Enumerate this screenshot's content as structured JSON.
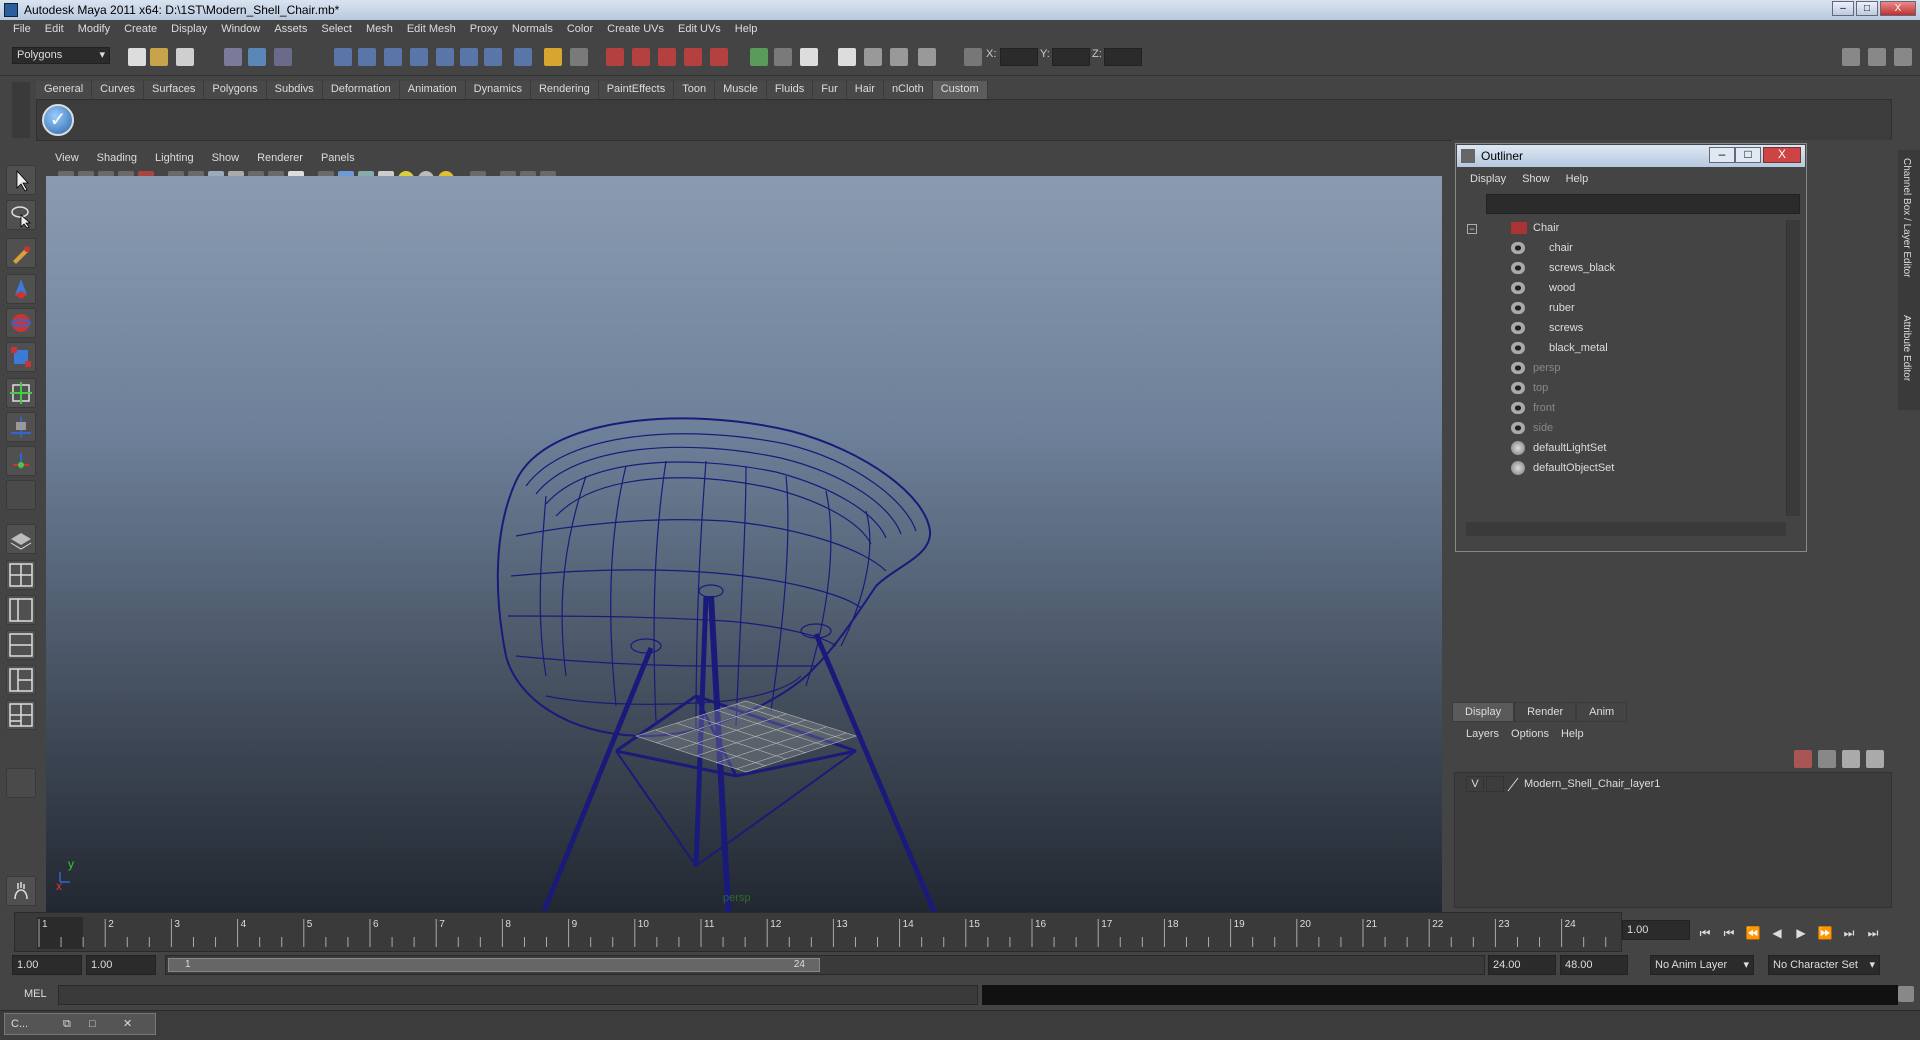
{
  "window": {
    "title": "Autodesk Maya 2011 x64: D:\\1ST\\Modern_Shell_Chair.mb*",
    "minimize": "–",
    "maximize": "□",
    "close": "X"
  },
  "menubar": [
    "File",
    "Edit",
    "Modify",
    "Create",
    "Display",
    "Window",
    "Assets",
    "Select",
    "Mesh",
    "Edit Mesh",
    "Proxy",
    "Normals",
    "Color",
    "Create UVs",
    "Edit UVs",
    "Help"
  ],
  "status_line": {
    "mode": "Polygons",
    "x_label": "X:",
    "y_label": "Y:",
    "z_label": "Z:"
  },
  "shelf": {
    "tabs": [
      "General",
      "Curves",
      "Surfaces",
      "Polygons",
      "Subdivs",
      "Deformation",
      "Animation",
      "Dynamics",
      "Rendering",
      "PaintEffects",
      "Toon",
      "Muscle",
      "Fluids",
      "Fur",
      "Hair",
      "nCloth",
      "Custom"
    ],
    "active_tab": "Custom"
  },
  "viewport": {
    "menu": [
      "View",
      "Shading",
      "Lighting",
      "Show",
      "Renderer",
      "Panels"
    ],
    "camera": "persp",
    "axis_x": "x",
    "axis_y": "y"
  },
  "outliner": {
    "title": "Outliner",
    "menu": [
      "Display",
      "Show",
      "Help"
    ],
    "items": [
      {
        "label": "Chair",
        "level": 0,
        "dim": false
      },
      {
        "label": "chair",
        "level": 1,
        "dim": false
      },
      {
        "label": "screws_black",
        "level": 1,
        "dim": false
      },
      {
        "label": "wood",
        "level": 1,
        "dim": false
      },
      {
        "label": "ruber",
        "level": 1,
        "dim": false
      },
      {
        "label": "screws",
        "level": 1,
        "dim": false
      },
      {
        "label": "black_metal",
        "level": 1,
        "dim": false
      },
      {
        "label": "persp",
        "level": 0,
        "dim": true
      },
      {
        "label": "top",
        "level": 0,
        "dim": true
      },
      {
        "label": "front",
        "level": 0,
        "dim": true
      },
      {
        "label": "side",
        "level": 0,
        "dim": true
      },
      {
        "label": "defaultLightSet",
        "level": 0,
        "dim": false
      },
      {
        "label": "defaultObjectSet",
        "level": 0,
        "dim": false
      }
    ]
  },
  "layer_editor": {
    "tabs": [
      "Display",
      "Render",
      "Anim"
    ],
    "active_tab": "Display",
    "menu": [
      "Layers",
      "Options",
      "Help"
    ],
    "layers": [
      {
        "visible": "V",
        "name": "Modern_Shell_Chair_layer1"
      }
    ]
  },
  "side_tabs": [
    "Channel Box / Layer Editor",
    "Attribute Editor"
  ],
  "timeline": {
    "ticks": [
      "1",
      "2",
      "3",
      "4",
      "5",
      "6",
      "7",
      "8",
      "9",
      "10",
      "11",
      "12",
      "13",
      "14",
      "15",
      "16",
      "17",
      "18",
      "19",
      "20",
      "21",
      "22",
      "23",
      "24"
    ],
    "current_frame": "1.00",
    "start_time": "1.00",
    "playback_start": "1.00",
    "range_start_label": "1",
    "range_end_label": "24",
    "playback_end": "24.00",
    "end_time": "48.00",
    "anim_layer": "No Anim Layer",
    "character_set": "No Character Set"
  },
  "command_line": {
    "label": "MEL"
  },
  "taskbar": {
    "item": "C..."
  },
  "colors": {
    "wireframe": "#1a1a7a",
    "viewport_top": "#8a9bb1",
    "viewport_bottom": "#222831"
  }
}
